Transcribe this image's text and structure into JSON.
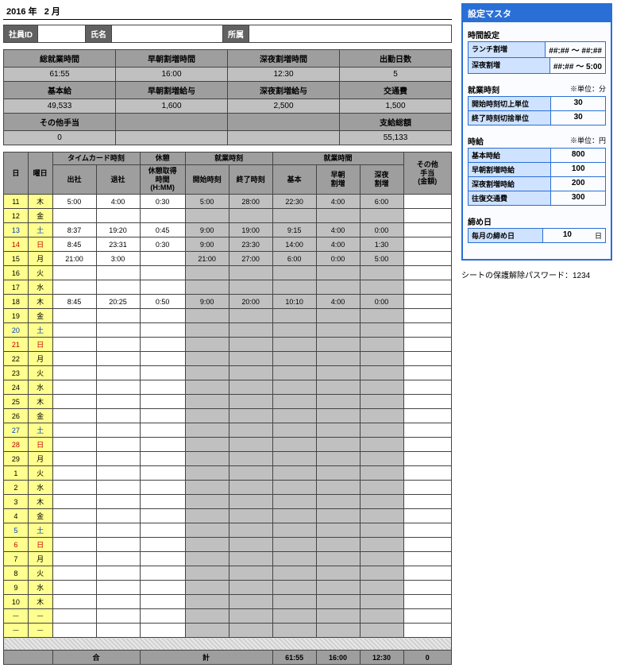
{
  "date": {
    "year": "2016",
    "year_lbl": "年",
    "month": "2",
    "month_lbl": "月"
  },
  "info": {
    "emp_id_lbl": "社員ID",
    "emp_id": "",
    "name_lbl": "氏名",
    "name": "",
    "dept_lbl": "所属",
    "dept": ""
  },
  "sum1": {
    "h1": "総就業時間",
    "h2": "早朝割増時間",
    "h3": "深夜割増時間",
    "h4": "出勤日数",
    "v1": "61:55",
    "v2": "16:00",
    "v3": "12:30",
    "v4": "5"
  },
  "sum2": {
    "h1": "基本給",
    "h2": "早朝割増給与",
    "h3": "深夜割増給与",
    "h4": "交通費",
    "v1": "49,533",
    "v2": "1,600",
    "v3": "2,500",
    "v4": "1,500"
  },
  "sum3": {
    "h1": "その他手当",
    "h4": "支給総額",
    "v1": "0",
    "v4": "55,133"
  },
  "gh": {
    "day": "日",
    "wd": "曜日",
    "tc": "タイムカード時刻",
    "in": "出社",
    "out": "退社",
    "brk": "休憩",
    "brk2": "休憩取得\n時間\n(H:MM)",
    "wt": "就業時刻",
    "st": "開始時刻",
    "et": "終了時刻",
    "wh": "就業時間",
    "base": "基本",
    "am": "早朝\n割増",
    "pm": "深夜\n割増",
    "oth": "その他\n手当\n(金額)"
  },
  "rows": [
    {
      "d": "11",
      "w": "木",
      "wc": "",
      "in": "5:00",
      "out": "4:00",
      "br": "0:30",
      "st": "5:00",
      "et": "28:00",
      "b": "22:30",
      "am": "4:00",
      "pm": "6:00",
      "o": ""
    },
    {
      "d": "12",
      "w": "金",
      "wc": ""
    },
    {
      "d": "13",
      "w": "土",
      "wc": "sat",
      "in": "8:37",
      "out": "19:20",
      "br": "0:45",
      "st": "9:00",
      "et": "19:00",
      "b": "9:15",
      "am": "4:00",
      "pm": "0:00",
      "o": ""
    },
    {
      "d": "14",
      "w": "日",
      "wc": "sun",
      "in": "8:45",
      "out": "23:31",
      "br": "0:30",
      "st": "9:00",
      "et": "23:30",
      "b": "14:00",
      "am": "4:00",
      "pm": "1:30",
      "o": ""
    },
    {
      "d": "15",
      "w": "月",
      "wc": "",
      "in": "21:00",
      "out": "3:00",
      "br": "",
      "st": "21:00",
      "et": "27:00",
      "b": "6:00",
      "am": "0:00",
      "pm": "5:00",
      "o": ""
    },
    {
      "d": "16",
      "w": "火",
      "wc": ""
    },
    {
      "d": "17",
      "w": "水",
      "wc": ""
    },
    {
      "d": "18",
      "w": "木",
      "wc": "",
      "in": "8:45",
      "out": "20:25",
      "br": "0:50",
      "st": "9:00",
      "et": "20:00",
      "b": "10:10",
      "am": "4:00",
      "pm": "0:00",
      "o": ""
    },
    {
      "d": "19",
      "w": "金",
      "wc": ""
    },
    {
      "d": "20",
      "w": "土",
      "wc": "sat"
    },
    {
      "d": "21",
      "w": "日",
      "wc": "sun"
    },
    {
      "d": "22",
      "w": "月",
      "wc": ""
    },
    {
      "d": "23",
      "w": "火",
      "wc": ""
    },
    {
      "d": "24",
      "w": "水",
      "wc": ""
    },
    {
      "d": "25",
      "w": "木",
      "wc": ""
    },
    {
      "d": "26",
      "w": "金",
      "wc": ""
    },
    {
      "d": "27",
      "w": "土",
      "wc": "sat"
    },
    {
      "d": "28",
      "w": "日",
      "wc": "sun"
    },
    {
      "d": "29",
      "w": "月",
      "wc": ""
    },
    {
      "d": "1",
      "w": "火",
      "wc": ""
    },
    {
      "d": "2",
      "w": "水",
      "wc": ""
    },
    {
      "d": "3",
      "w": "木",
      "wc": ""
    },
    {
      "d": "4",
      "w": "金",
      "wc": ""
    },
    {
      "d": "5",
      "w": "土",
      "wc": "sat"
    },
    {
      "d": "6",
      "w": "日",
      "wc": "sun"
    },
    {
      "d": "7",
      "w": "月",
      "wc": ""
    },
    {
      "d": "8",
      "w": "火",
      "wc": ""
    },
    {
      "d": "9",
      "w": "水",
      "wc": ""
    },
    {
      "d": "10",
      "w": "木",
      "wc": ""
    },
    {
      "d": "ー",
      "w": "ー",
      "wc": "dash"
    },
    {
      "d": "ー",
      "w": "ー",
      "wc": "dash"
    }
  ],
  "total": {
    "lbl1": "合",
    "lbl2": "計",
    "b": "61:55",
    "am": "16:00",
    "pm": "12:30",
    "o": "0"
  },
  "master": {
    "title": "設定マスタ",
    "g1": {
      "hdr": "時間設定",
      "r1l": "ランチ割増",
      "r1v": "##:## ～ ##:##",
      "r2l": "深夜割増",
      "r2v": "##:## ～ 5:00"
    },
    "g2": {
      "hdr": "就業時刻",
      "note": "※単位：分",
      "r1l": "開始時刻切上単位",
      "r1v": "30",
      "r2l": "終了時刻切捨単位",
      "r2v": "30"
    },
    "g3": {
      "hdr": "時給",
      "note": "※単位：円",
      "r1l": "基本時給",
      "r1v": "800",
      "r2l": "早朝割増時給",
      "r2v": "100",
      "r3l": "深夜割増時給",
      "r3v": "200",
      "r4l": "往復交通費",
      "r4v": "300"
    },
    "g4": {
      "hdr": "締め日",
      "r1l": "毎月の締め日",
      "r1v": "10",
      "r1s": "日"
    }
  },
  "pwnote": "シートの保護解除パスワード：1234"
}
